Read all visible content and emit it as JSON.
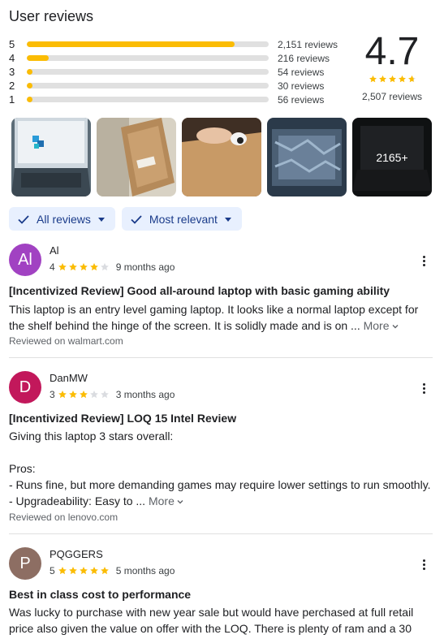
{
  "section_title": "User reviews",
  "colors": {
    "star": "#fbbc04",
    "star_empty": "#dadce0",
    "chip_bg": "#e8f0fe",
    "chip_text": "#1a3b8a"
  },
  "rating_distribution": [
    {
      "stars": "5",
      "count": "2,151 reviews",
      "fraction": 0.86
    },
    {
      "stars": "4",
      "count": "216 reviews",
      "fraction": 0.09
    },
    {
      "stars": "3",
      "count": "54 reviews",
      "fraction": 0.025
    },
    {
      "stars": "2",
      "count": "30 reviews",
      "fraction": 0.025
    },
    {
      "stars": "1",
      "count": "56 reviews",
      "fraction": 0.025
    }
  ],
  "overall": {
    "score": "4.7",
    "stars": 4.7,
    "count": "2,507 reviews"
  },
  "photos": {
    "more_label": "2165+"
  },
  "filters": [
    {
      "label": "All reviews",
      "icon": "check-icon"
    },
    {
      "label": "Most relevant",
      "icon": "check-icon"
    }
  ],
  "reviews": [
    {
      "initials": "Al",
      "avatar_color": "#a142c2",
      "author": "Al",
      "rating": "4",
      "rating_value": 4,
      "date": "9 months ago",
      "title": "[Incentivized Review] Good all-around laptop with basic gaming ability",
      "body_lines": [
        "This laptop is an entry level gaming laptop. It looks like a normal laptop except for",
        "the shelf behind the hinge of the screen. It is solidly made and is on ..."
      ],
      "more_label": "More",
      "source": "Reviewed on walmart.com"
    },
    {
      "initials": "D",
      "avatar_color": "#c2185b",
      "author": "DanMW",
      "rating": "3",
      "rating_value": 3,
      "date": "3 months ago",
      "title": "[Incentivized Review] LOQ 15 Intel Review",
      "body_lines": [
        "Giving this laptop 3 stars overall:",
        "",
        "Pros:",
        "- Runs fine, but more demanding games may require lower settings to run smoothly.",
        "- Upgradeability: Easy to ..."
      ],
      "more_label": "More",
      "source": "Reviewed on lenovo.com"
    },
    {
      "initials": "P",
      "avatar_color": "#8d6e63",
      "author": "PQGGERS",
      "rating": "5",
      "rating_value": 5,
      "date": "5 months ago",
      "title": "Best in class cost to performance",
      "body_lines": [
        "Was lucky to purchase with new year sale but would have perchased at full retail",
        "price also given the value on offer with the LOQ. There is plenty of ram and a 30"
      ],
      "more_label": "",
      "source": ""
    }
  ]
}
